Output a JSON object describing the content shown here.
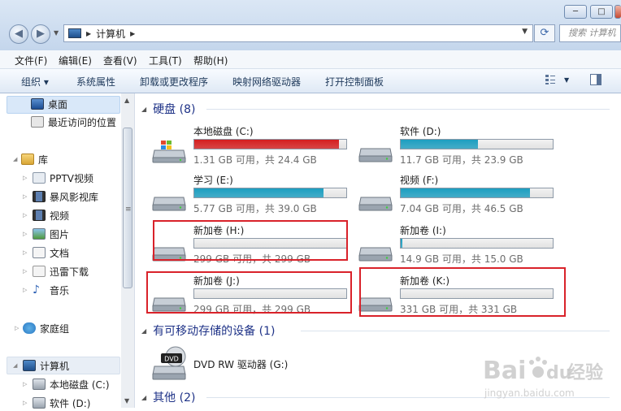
{
  "window": {
    "minimize": "─",
    "maximize": "□"
  },
  "address": {
    "crumb": "计算机",
    "search_placeholder": "搜索 计算机"
  },
  "menu": [
    "文件(F)",
    "编辑(E)",
    "查看(V)",
    "工具(T)",
    "帮助(H)"
  ],
  "commands": {
    "organize": "组织 ▾",
    "system_properties": "系统属性",
    "uninstall": "卸载或更改程序",
    "map_drive": "映射网络驱动器",
    "control_panel": "打开控制面板"
  },
  "nav": {
    "favorites": [
      "桌面",
      "最近访问的位置"
    ],
    "library": "库",
    "library_items": [
      "PPTV视频",
      "暴风影视库",
      "视频",
      "图片",
      "文档",
      "迅雷下载",
      "音乐"
    ],
    "homegroup": "家庭组",
    "computer": "计算机",
    "computer_items": [
      "本地磁盘 (C:)",
      "软件 (D:)"
    ]
  },
  "groups": {
    "hdd": "硬盘 (8)",
    "removable": "有可移动存储的设备 (1)",
    "other": "其他 (2)"
  },
  "drives": [
    {
      "name": "本地磁盘 (C:)",
      "info": "1.31 GB 可用，共 24.4 GB",
      "used_fraction": 0.95,
      "color": "#d41e1e"
    },
    {
      "name": "软件 (D:)",
      "info": "11.7 GB 可用，共 23.9 GB",
      "used_fraction": 0.51,
      "color": "#1c9ec0"
    },
    {
      "name": "学习 (E:)",
      "info": "5.77 GB 可用，共 39.0 GB",
      "used_fraction": 0.85,
      "color": "#1c9ec0"
    },
    {
      "name": "视频 (F:)",
      "info": "7.04 GB 可用，共 46.5 GB",
      "used_fraction": 0.85,
      "color": "#1c9ec0"
    },
    {
      "name": "新加卷 (H:)",
      "info": "299 GB 可用，共 299 GB",
      "used_fraction": 0.0,
      "color": "#1c9ec0"
    },
    {
      "name": "新加卷 (I:)",
      "info": "14.9 GB 可用，共 15.0 GB",
      "used_fraction": 0.01,
      "color": "#1c9ec0"
    },
    {
      "name": "新加卷 (J:)",
      "info": "299 GB 可用，共 299 GB",
      "used_fraction": 0.0,
      "color": "#1c9ec0"
    },
    {
      "name": "新加卷 (K:)",
      "info": "331 GB 可用，共 331 GB",
      "used_fraction": 0.0,
      "color": "#1c9ec0"
    }
  ],
  "dvd": {
    "name": "DVD RW 驱动器 (G:)",
    "label": "DVD"
  },
  "watermark": {
    "brand": "Bai",
    "brand2": "du",
    "cn": "经验",
    "url": "jingyan.baidu.com"
  }
}
